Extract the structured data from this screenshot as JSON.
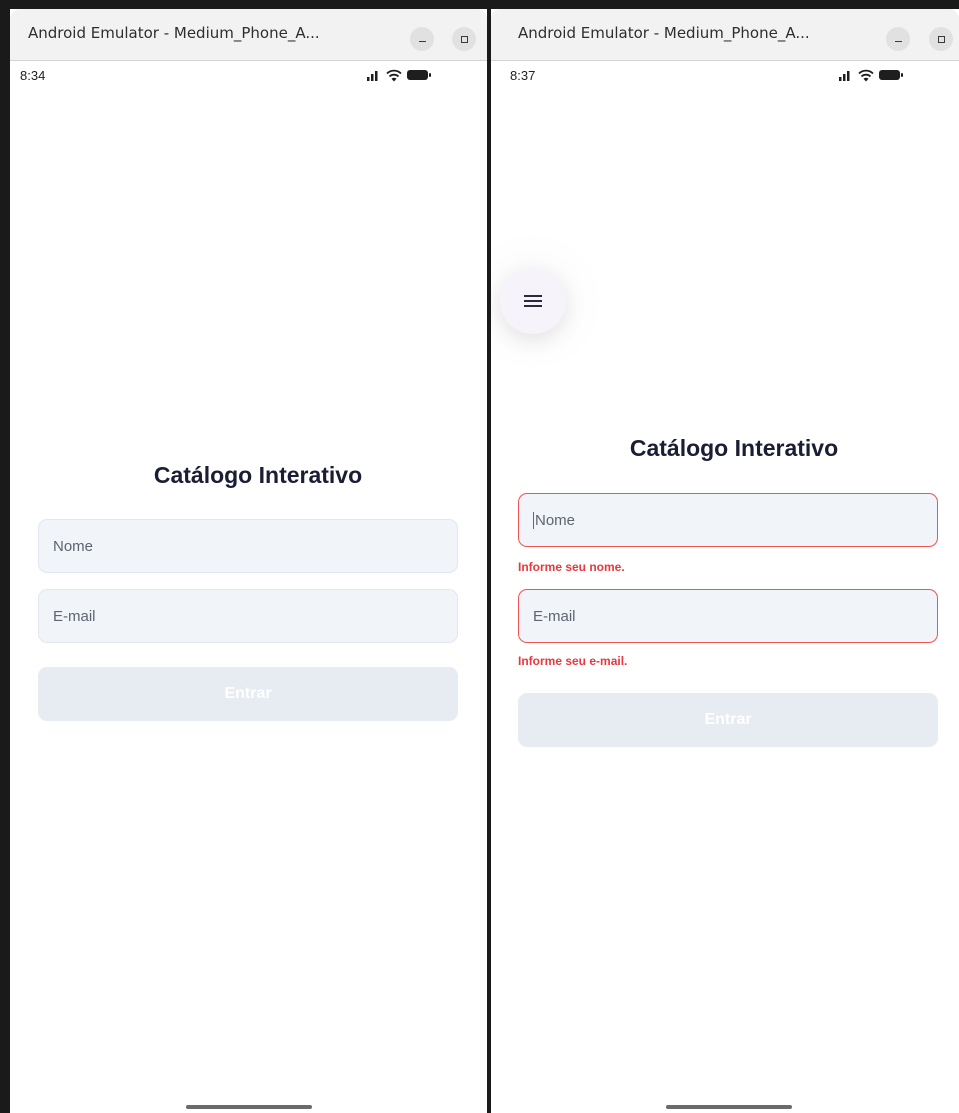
{
  "left_window": {
    "title": "Android Emulator - Medium_Phone_A...",
    "status_time": "8:34",
    "app_title": "Catálogo Interativo",
    "name_placeholder": "Nome",
    "email_placeholder": "E-mail",
    "submit_label": "Entrar"
  },
  "right_window": {
    "title": "Android Emulator - Medium_Phone_A...",
    "status_time": "8:37",
    "app_title": "Catálogo Interativo",
    "name_placeholder": "Nome",
    "name_error": "Informe seu nome.",
    "email_placeholder": "E-mail",
    "email_error": "Informe seu e-mail.",
    "submit_label": "Entrar",
    "menu_icon": "hamburger-menu-icon"
  },
  "colors": {
    "title_text": "#1a1d33",
    "field_bg": "#f1f4f9",
    "error": "#e8383d",
    "button_disabled": "#e7ebf2"
  }
}
